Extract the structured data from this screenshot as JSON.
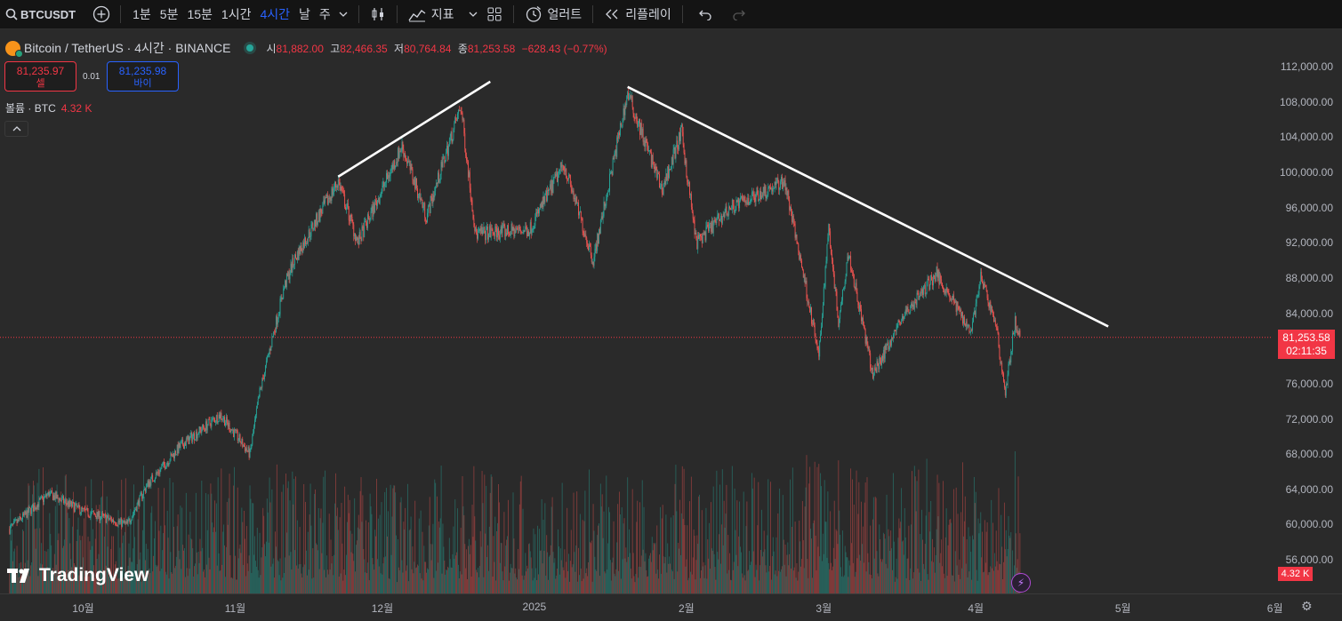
{
  "toolbar": {
    "symbol": "BTCUSDT",
    "timeframes": [
      {
        "label": "1분",
        "active": false
      },
      {
        "label": "5분",
        "active": false
      },
      {
        "label": "15분",
        "active": false
      },
      {
        "label": "1시간",
        "active": false
      },
      {
        "label": "4시간",
        "active": true
      },
      {
        "label": "날",
        "active": false
      },
      {
        "label": "주",
        "active": false
      }
    ],
    "indicators_label": "지표",
    "alerts_label": "얼러트",
    "replay_label": "리플레이",
    "icons": [
      "search-icon",
      "add-symbol-icon",
      "chevron-down-icon",
      "candle-type-icon",
      "indicators-icon",
      "layout-grid-icon",
      "alert-clock-icon",
      "replay-icon",
      "undo-icon",
      "redo-icon"
    ]
  },
  "legend": {
    "title": "Bitcoin / TetherUS · 4시간 · BINANCE",
    "open_label": "시",
    "open": "81,882.00",
    "high_label": "고",
    "high": "82,466.35",
    "low_label": "저",
    "low": "80,764.84",
    "close_label": "종",
    "close": "81,253.58",
    "change": "−628.43 (−0.77%)"
  },
  "trade": {
    "sell_price": "81,235.97",
    "sell_label": "셀",
    "spread": "0.01",
    "buy_price": "81,235.98",
    "buy_label": "바이"
  },
  "volume": {
    "label": "볼륨 · BTC",
    "value": "4.32 K",
    "tag": "4.32 K"
  },
  "current_price": {
    "price": "81,253.58",
    "countdown": "02:11:35"
  },
  "price_axis": [
    "112,000.00",
    "108,000.00",
    "104,000.00",
    "100,000.00",
    "96,000.00",
    "92,000.00",
    "88,000.00",
    "84,000.00",
    "80,000.00",
    "76,000.00",
    "72,000.00",
    "68,000.00",
    "64,000.00",
    "60,000.00",
    "56,000.00"
  ],
  "time_axis": [
    "10월",
    "11월",
    "12월",
    "2025",
    "2월",
    "3월",
    "4월",
    "5월",
    "6월"
  ],
  "branding": "TradingView",
  "colors": {
    "up": "#26a69a",
    "down": "#ef5350",
    "accent": "#2962ff",
    "price_line": "#f23645",
    "trendline": "#ffffff"
  },
  "chart_data": {
    "type": "candlestick",
    "interval": "4h",
    "price_range": [
      54000,
      114500
    ],
    "anchors": [
      {
        "date": "2024-09-16",
        "price": 59500
      },
      {
        "date": "2024-09-24",
        "price": 63500
      },
      {
        "date": "2024-10-01",
        "price": 61500
      },
      {
        "date": "2024-10-10",
        "price": 60000
      },
      {
        "date": "2024-10-14",
        "price": 64500
      },
      {
        "date": "2024-10-21",
        "price": 69000
      },
      {
        "date": "2024-10-29",
        "price": 72500
      },
      {
        "date": "2024-11-04",
        "price": 68000
      },
      {
        "date": "2024-11-06",
        "price": 75000
      },
      {
        "date": "2024-11-11",
        "price": 87000
      },
      {
        "date": "2024-11-13",
        "price": 90000
      },
      {
        "date": "2024-11-22",
        "price": 99000
      },
      {
        "date": "2024-11-26",
        "price": 92000
      },
      {
        "date": "2024-12-05",
        "price": 103000
      },
      {
        "date": "2024-12-10",
        "price": 95000
      },
      {
        "date": "2024-12-17",
        "price": 107500
      },
      {
        "date": "2024-12-20",
        "price": 93000
      },
      {
        "date": "2024-12-31",
        "price": 93500
      },
      {
        "date": "2025-01-07",
        "price": 101000
      },
      {
        "date": "2025-01-13",
        "price": 90000
      },
      {
        "date": "2025-01-20",
        "price": 109000
      },
      {
        "date": "2025-01-27",
        "price": 98000
      },
      {
        "date": "2025-01-31",
        "price": 104500
      },
      {
        "date": "2025-02-03",
        "price": 92000
      },
      {
        "date": "2025-02-10",
        "price": 96000
      },
      {
        "date": "2025-02-21",
        "price": 99000
      },
      {
        "date": "2025-02-25",
        "price": 88000
      },
      {
        "date": "2025-02-28",
        "price": 79000
      },
      {
        "date": "2025-03-02",
        "price": 94000
      },
      {
        "date": "2025-03-04",
        "price": 83000
      },
      {
        "date": "2025-03-06",
        "price": 91000
      },
      {
        "date": "2025-03-11",
        "price": 77000
      },
      {
        "date": "2025-03-17",
        "price": 83500
      },
      {
        "date": "2025-03-24",
        "price": 88500
      },
      {
        "date": "2025-03-31",
        "price": 82000
      },
      {
        "date": "2025-04-02",
        "price": 88000
      },
      {
        "date": "2025-04-05",
        "price": 83000
      },
      {
        "date": "2025-04-07",
        "price": 75000
      },
      {
        "date": "2025-04-09",
        "price": 83000
      },
      {
        "date": "2025-04-10",
        "price": 81253.58
      }
    ],
    "trendlines": [
      {
        "name": "rising-trendline",
        "from": {
          "date": "2024-11-22",
          "price": 99500
        },
        "to": {
          "date": "2024-12-23",
          "price": 110300
        }
      },
      {
        "name": "falling-trendline",
        "from": {
          "date": "2025-01-20",
          "price": 109700
        },
        "to": {
          "date": "2025-04-28",
          "price": 82500
        }
      }
    ]
  }
}
